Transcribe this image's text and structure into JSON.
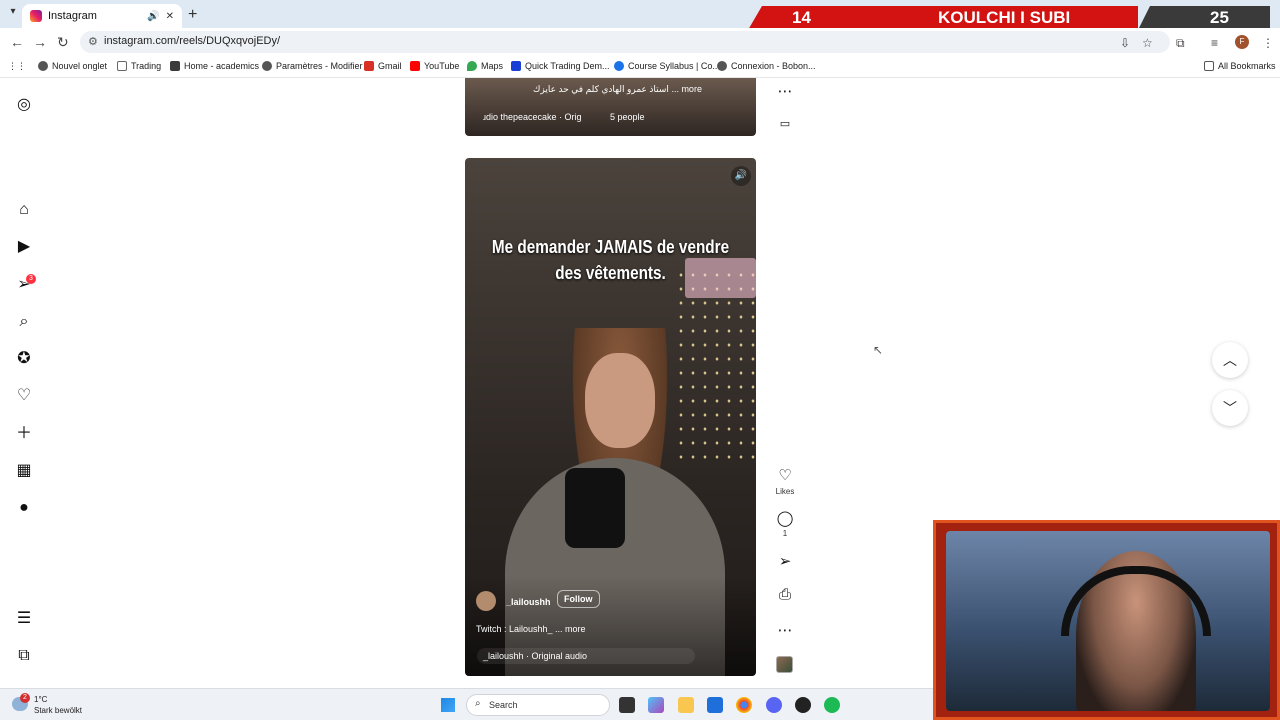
{
  "browser": {
    "tab_title": "Instagram",
    "tab_close": "✕",
    "new_tab": "+",
    "url": "instagram.com/reels/DUQxqvojEDy/",
    "profile_initial": "F",
    "bookmarks": [
      {
        "label": "Nouvel onglet",
        "color": "#555"
      },
      {
        "label": "Trading",
        "color": "#888"
      },
      {
        "label": "Home - academics",
        "color": "#3a3a3a"
      },
      {
        "label": "Paramètres - Modifier",
        "color": "#555"
      },
      {
        "label": "Gmail",
        "color": "#d93025"
      },
      {
        "label": "YouTube",
        "color": "#ff0000"
      },
      {
        "label": "Maps",
        "color": "#34a853"
      },
      {
        "label": "Quick Trading Dem...",
        "color": "#1a3fd6"
      },
      {
        "label": "Course Syllabus | Co...",
        "color": "#1a73e8"
      },
      {
        "label": "Connexion - Bobon...",
        "color": "#555"
      }
    ],
    "all_bookmarks": "All Bookmarks"
  },
  "stream_overlay": {
    "left_number": "14",
    "title": "KOULCHI I SUBI",
    "right_number": "25"
  },
  "instagram": {
    "sidebar_icons": [
      "instagram-logo-icon",
      "home-icon",
      "reels-icon",
      "messages-icon",
      "search-icon",
      "explore-icon",
      "notifications-icon",
      "create-icon",
      "dashboard-icon",
      "profile-avatar",
      "menu-icon",
      "threads-icon"
    ],
    "messages_badge": "3",
    "previous_reel": {
      "caption": "استاذ عمرو الهادي كلم في حد عايزك ... more",
      "audio": "ɹdio   thepeacecake · Orig",
      "people": "5 people"
    },
    "current_reel": {
      "overlay_text_line1": "Me demander JAMAIS de vendre",
      "overlay_text_line2": "des vêtements.",
      "username": "_lailoushh",
      "follow_label": "Follow",
      "caption": "Twitch : Lailoushh_ ... more",
      "audio": "_lailoushh · Original audio"
    },
    "actions": {
      "likes_label": "Likes",
      "comments_count": "1"
    }
  },
  "taskbar": {
    "temperature": "1°C",
    "weather": "Stark bewölkt",
    "weather_badge": "2",
    "search_placeholder": "Search"
  }
}
